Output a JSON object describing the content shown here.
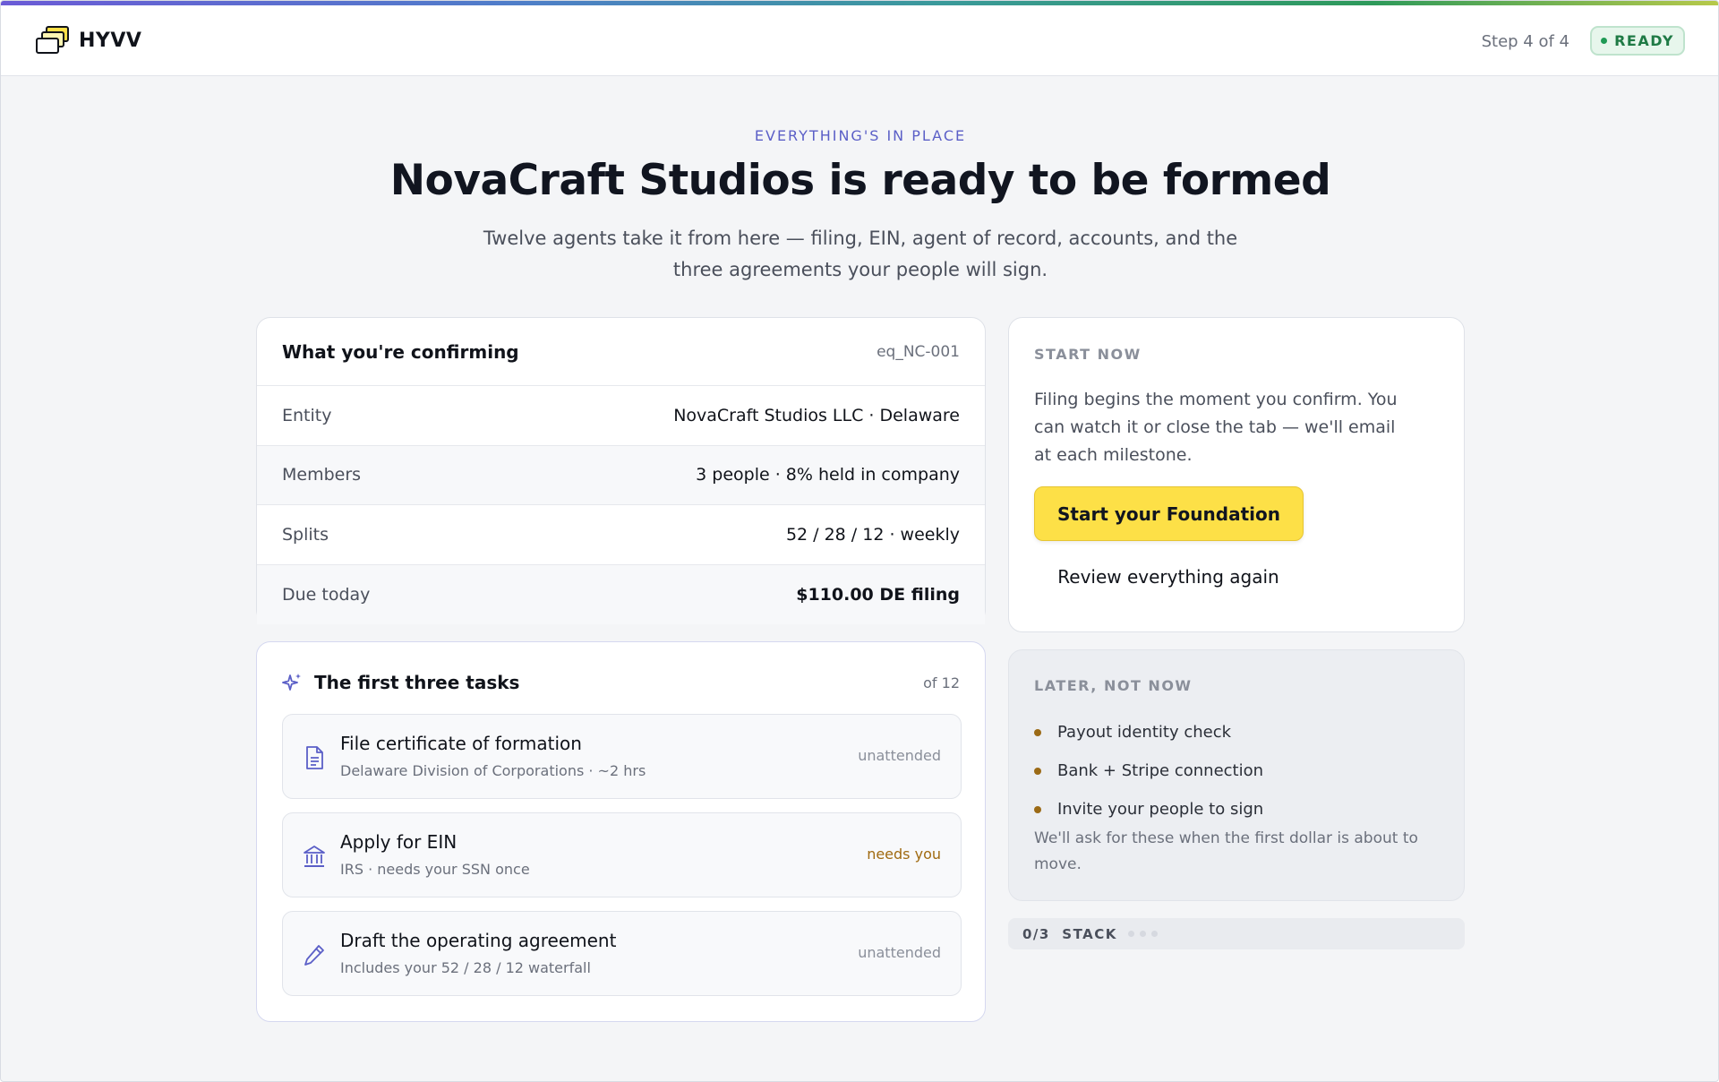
{
  "header": {
    "brand": "HYVV",
    "step": "Step 4 of 4",
    "status": "READY"
  },
  "hero": {
    "eyebrow": "EVERYTHING'S IN PLACE",
    "title": "NovaCraft Studios is ready to be formed",
    "lede": "Twelve agents take it from here — filing, EIN, agent of record, accounts, and the three agreements your people will sign."
  },
  "confirm": {
    "title": "What you're confirming",
    "id": "eq_NC-001",
    "rows": [
      {
        "label": "Entity",
        "value": "NovaCraft Studios LLC · Delaware"
      },
      {
        "label": "Members",
        "value": "3 people · 8% held in company"
      },
      {
        "label": "Splits",
        "value": "52 / 28 / 12 · weekly"
      },
      {
        "label": "Due today",
        "value": "$110.00 DE filing"
      }
    ]
  },
  "tasks": {
    "title": "The first three tasks",
    "count": "of 12",
    "items": [
      {
        "icon": "document-icon",
        "title": "File certificate of formation",
        "subtitle": "Delaware Division of Corporations · ~2 hrs",
        "status": "unattended"
      },
      {
        "icon": "bank-icon",
        "title": "Apply for EIN",
        "subtitle": "IRS · needs your SSN once",
        "status": "needs you"
      },
      {
        "icon": "pen-icon",
        "title": "Draft the operating agreement",
        "subtitle": "Includes your 52 / 28 / 12 waterfall",
        "status": "unattended"
      }
    ]
  },
  "start": {
    "label": "START NOW",
    "description": "Filing begins the moment you confirm. You can watch it or close the tab — we'll email at each milestone.",
    "primary": "Start your Foundation",
    "secondary": "Review everything again"
  },
  "later": {
    "label": "LATER, NOT NOW",
    "items": [
      "Payout identity check",
      "Bank + Stripe connection",
      "Invite your people to sign"
    ],
    "note": "We'll ask for these when the first dollar is about to move."
  },
  "stack": {
    "label": "0/3  STACK",
    "completed": 0,
    "total": 3
  },
  "colors": {
    "accent": "#5b5fc7",
    "primary_button": "#fde047",
    "ready": "#1f7a45",
    "warn": "#a06a10"
  }
}
